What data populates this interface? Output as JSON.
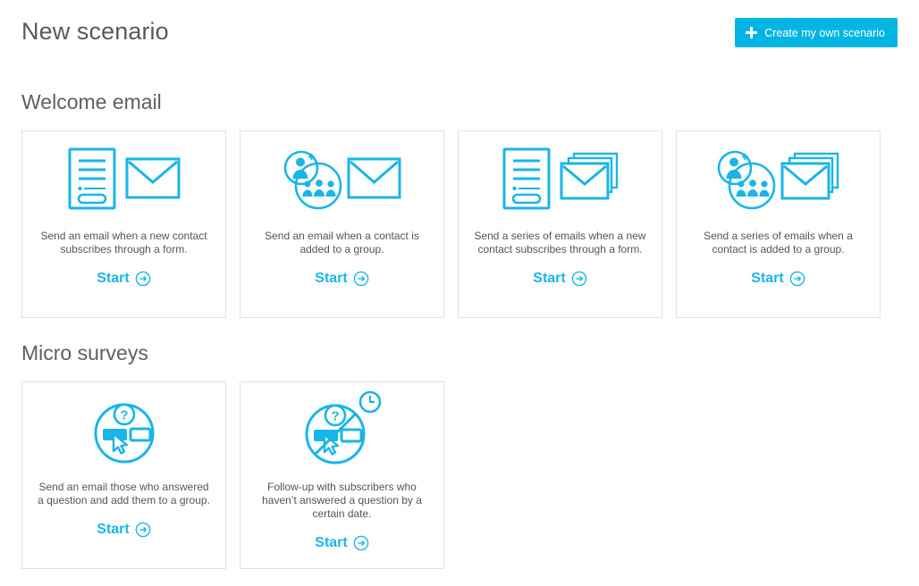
{
  "header": {
    "title": "New scenario",
    "create_button": {
      "label": "Create my own scenario",
      "icon": "plus-icon",
      "bg_color": "#00b5e2",
      "text_color": "#ffffff"
    }
  },
  "theme": {
    "accent": "#19b5e8",
    "accent_button": "#00b5e2",
    "card_border": "#e2e2e2",
    "title_color": "#5a5a5a",
    "body_text": "#555555",
    "background": "#ffffff"
  },
  "start_label": "Start",
  "start_icon": "arrow-right-circle-icon",
  "sections": [
    {
      "title": "Welcome email",
      "cards": [
        {
          "icon": "form-and-envelope-icon",
          "description": "Send an email when a new contact subscribes through a form.",
          "action": "Start"
        },
        {
          "icon": "contacts-group-and-envelope-icon",
          "description": "Send an email when a contact is added to a group.",
          "action": "Start"
        },
        {
          "icon": "form-and-envelope-stack-icon",
          "description": "Send a series of emails when a new contact subscribes through a form.",
          "action": "Start"
        },
        {
          "icon": "contacts-group-and-envelope-stack-icon",
          "description": "Send a series of emails when a contact is added to a group.",
          "action": "Start"
        }
      ]
    },
    {
      "title": "Micro surveys",
      "cards": [
        {
          "icon": "survey-answered-icon",
          "description": "Send an email those who answered a question and add them to a group.",
          "action": "Start"
        },
        {
          "icon": "survey-unanswered-clock-icon",
          "description": "Follow-up with subscribers who haven’t answered a question by a certain date.",
          "action": "Start"
        }
      ]
    }
  ]
}
